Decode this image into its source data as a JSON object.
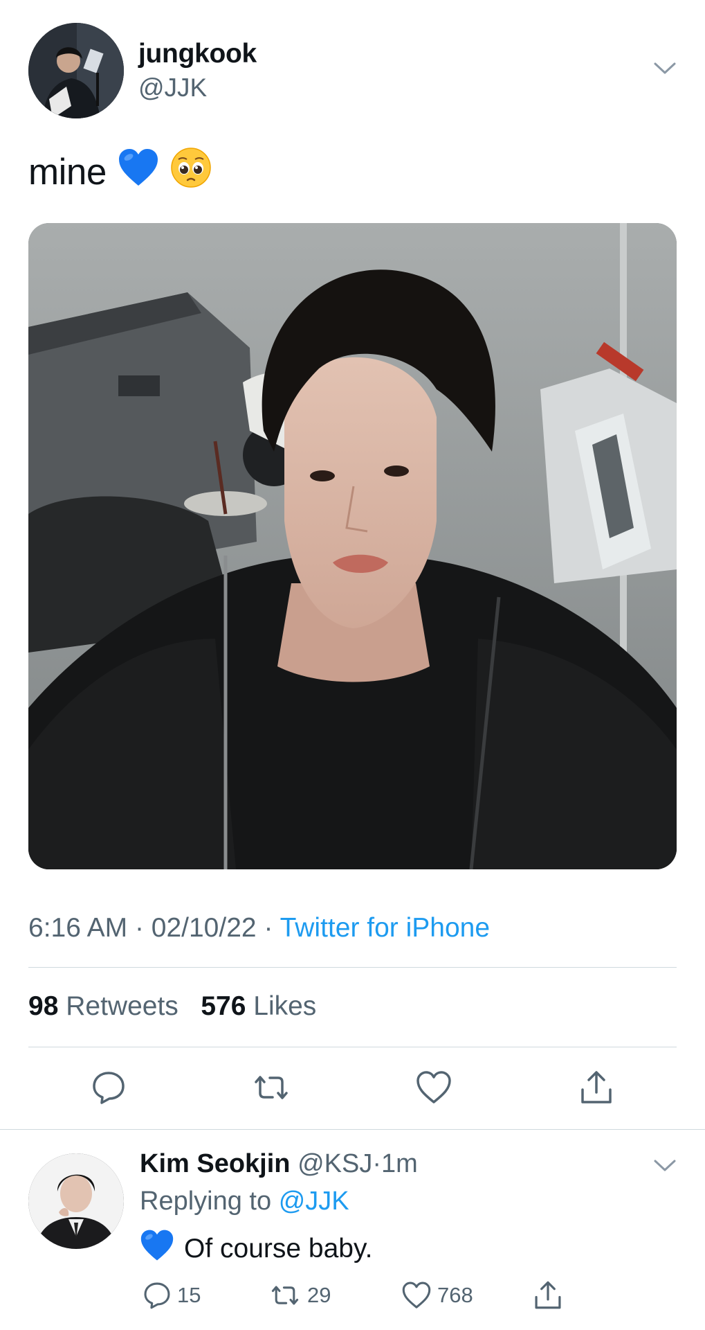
{
  "tweet": {
    "author_name": "jungkook",
    "author_handle": "@JJK",
    "text": "mine",
    "emojis": [
      "blue-heart",
      "pleading-face"
    ],
    "time": "6:16 AM",
    "date": "02/10/22",
    "separator": "·",
    "source": "Twitter for iPhone",
    "retweets_count": "98",
    "retweets_label": "Retweets",
    "likes_count": "576",
    "likes_label": "Likes"
  },
  "reply": {
    "author_name": "Kim Seokjin",
    "author_handle": "@KSJ",
    "separator": "·",
    "time": "1m",
    "replying_prefix": "Replying to",
    "replying_to": "@JJK",
    "emoji": "blue-heart",
    "text": "Of course baby.",
    "reply_count": "15",
    "retweet_count": "29",
    "like_count": "768"
  },
  "colors": {
    "link": "#1d9bf0",
    "secondary_text": "#536471",
    "divider": "#cfd9de",
    "heart_blue": "#1877f2"
  }
}
